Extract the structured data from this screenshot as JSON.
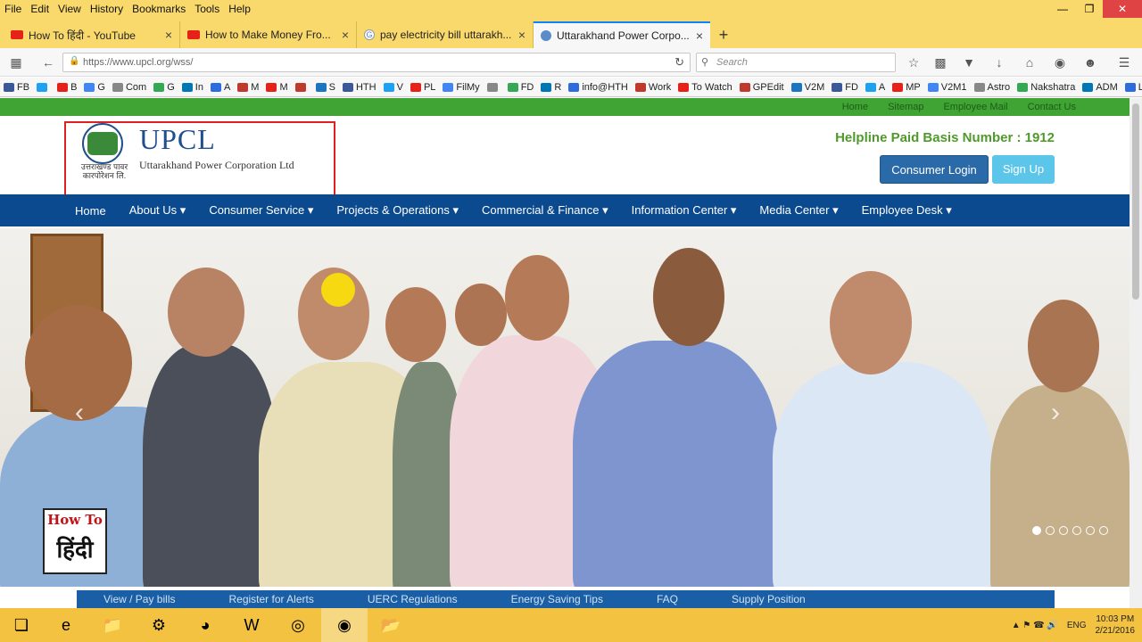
{
  "menubar": {
    "items": [
      "File",
      "Edit",
      "View",
      "History",
      "Bookmarks",
      "Tools",
      "Help"
    ]
  },
  "tabs": [
    {
      "title": "How To हिंदी - YouTube",
      "icon": "youtube-icon"
    },
    {
      "title": "How to Make Money Fro...",
      "icon": "youtube-icon"
    },
    {
      "title": "pay electricity bill uttarakh...",
      "icon": "google-icon"
    },
    {
      "title": "Uttarakhand Power Corpo...",
      "icon": "upcl-icon",
      "active": true
    }
  ],
  "nav": {
    "url": "https://www.upcl.org/wss/",
    "search_placeholder": "Search"
  },
  "bookmarks": [
    "FB",
    "",
    "B",
    "G",
    "Com",
    "G",
    "In",
    "A",
    "M",
    "M",
    "",
    "S",
    "HTH",
    "V",
    "PL",
    "FilMy",
    "",
    "FD",
    "R",
    "info@HTH",
    "Work",
    "To Watch",
    "GPEdit",
    "V2M",
    "FD",
    "A",
    "MP",
    "V2M1",
    "Astro",
    "Nakshatra",
    "ADM",
    "LS"
  ],
  "site": {
    "toplinks": [
      "Home",
      "Sitemap",
      "Employee Mail",
      "Contact Us"
    ],
    "logo_title": "UPCL",
    "logo_subtitle": "Uttarakhand Power Corporation Ltd",
    "logo_hindi": "उत्तराखण्ड पावर कारपोरेशन लि.",
    "helpline": "Helpline Paid Basis Number : 1912",
    "login_label": "Consumer Login",
    "signup_label": "Sign Up",
    "menu": [
      "Home",
      "About Us ▾",
      "Consumer Service ▾",
      "Projects & Operations ▾",
      "Commercial & Finance ▾",
      "Information Center ▾",
      "Media Center ▾",
      "Employee Desk ▾"
    ],
    "carousel": {
      "slides": 6,
      "active": 1
    },
    "quicklinks": [
      "View / Pay bills",
      "Register for Alerts",
      "UERC Regulations",
      "Energy Saving Tips",
      "FAQ",
      "Supply Position"
    ]
  },
  "watermark": {
    "line1": "How To",
    "line2": "हिंदी"
  },
  "taskbar": {
    "lang": "ENG",
    "time": "10:03 PM",
    "date": "2/21/2016"
  },
  "colors": {
    "firefox_chrome": "#f9d96b",
    "green_strip": "#3fa434",
    "nav_blue": "#0b4a8e",
    "login_blue": "#2a6aa8",
    "signup_cyan": "#5bc6ea",
    "helpline_green": "#4f9a2a"
  }
}
